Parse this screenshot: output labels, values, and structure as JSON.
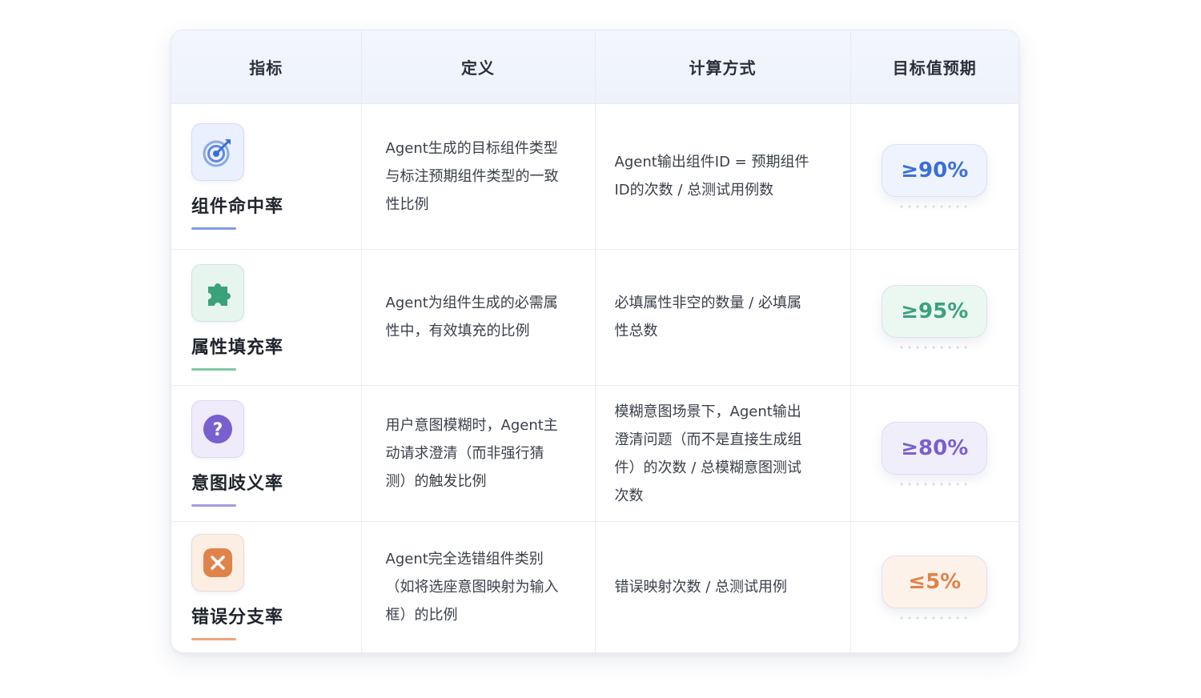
{
  "headers": [
    "指标",
    "定义",
    "计算方式",
    "目标值预期"
  ],
  "rows": [
    {
      "name": "组件命中率",
      "icon": "target-icon",
      "definition": [
        "Agent生成的目标组件类型",
        "与标注预期组件类型的一致",
        "性比例"
      ],
      "calculation": [
        "Agent输出组件ID = 预期组件",
        "ID的次数 / 总测试用例数"
      ],
      "target": "≥90%",
      "accent": "#3b6fd8",
      "pill_bg": "#eef3fe",
      "icon_bg": "#eaf0fd",
      "underline": "#7f9ce6"
    },
    {
      "name": "属性填充率",
      "icon": "puzzle-icon",
      "definition": [
        "Agent为组件生成的必需属",
        "性中，有效填充的比例"
      ],
      "calculation": [
        "必填属性非空的数量 / 必填属",
        "性总数"
      ],
      "target": "≥95%",
      "accent": "#3aa27a",
      "pill_bg": "#ebf7f1",
      "icon_bg": "#e7f5ef",
      "underline": "#7fc7a6"
    },
    {
      "name": "意图歧义率",
      "icon": "question-icon",
      "definition": [
        "用户意图模糊时，Agent主",
        "动请求澄清（而非强行猜",
        "测）的触发比例"
      ],
      "calculation": [
        "模糊意图场景下，Agent输出",
        "澄清问题（而不是直接生成组",
        "件）的次数 / 总模糊意图测试",
        "次数"
      ],
      "target": "≥80%",
      "accent": "#7a5fcf",
      "pill_bg": "#f1eefc",
      "icon_bg": "#efebfb",
      "underline": "#a898e2"
    },
    {
      "name": "错误分支率",
      "icon": "close-icon",
      "definition": [
        "Agent完全选错组件类别",
        "（如将选座意图映射为输入",
        "框）的比例"
      ],
      "calculation": [
        "错误映射次数 / 总测试用例"
      ],
      "target": "≤5%",
      "accent": "#e0834a",
      "pill_bg": "#fdf2ea",
      "icon_bg": "#fdeee3",
      "underline": "#f0a57a"
    }
  ]
}
